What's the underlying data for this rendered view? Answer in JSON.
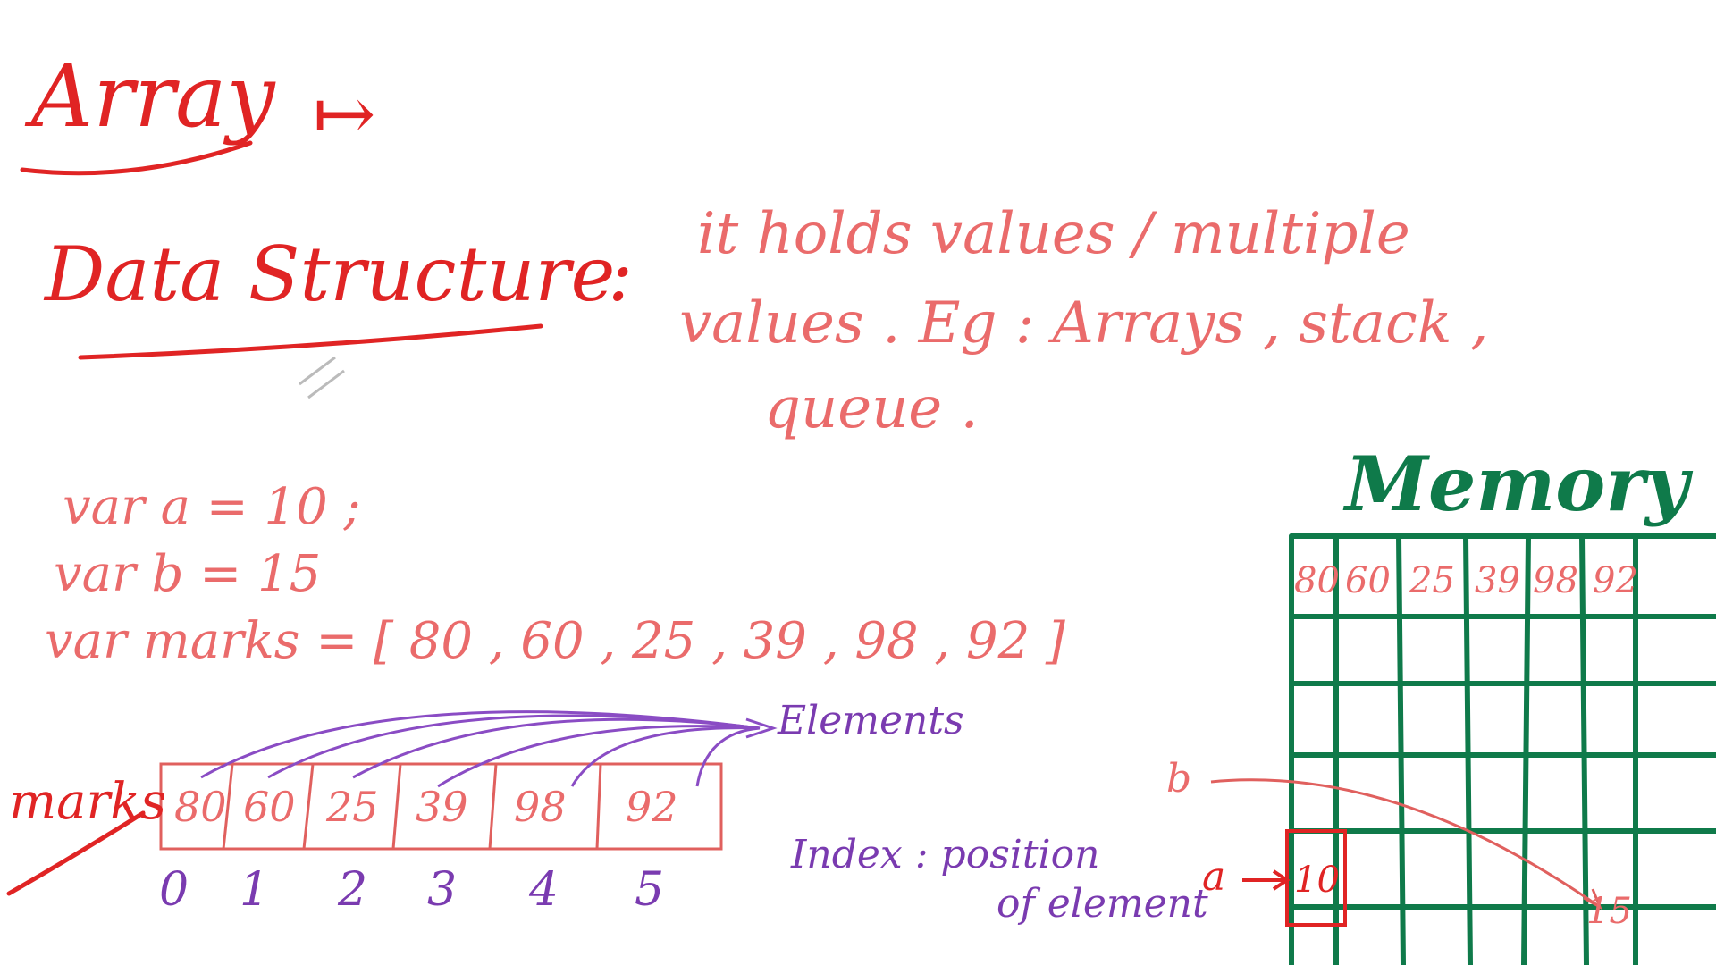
{
  "title": "Array",
  "title_arrow": "↦",
  "heading": "Data Structure",
  "heading_colon": ":",
  "definition": {
    "line1": "it holds values / multiple",
    "line2": "values . Eg : Arrays , stack ,",
    "line3": "queue ."
  },
  "code": {
    "line1": "var  a = 10 ;",
    "line2": "var  b = 15",
    "line3": "var marks = [ 80 , 60 , 25 , 39 , 98 , 92 ]"
  },
  "array_label": "marks",
  "array": {
    "cells": [
      "80",
      "60",
      "25",
      "39",
      "98",
      "92"
    ],
    "indices": [
      "0",
      "1",
      "2",
      "3",
      "4",
      "5"
    ]
  },
  "elements_label": "Elements",
  "index_note": {
    "line1": "Index : position",
    "line2": "of element"
  },
  "memory": {
    "title": "Memory",
    "top_row": [
      "80",
      "60",
      "25",
      "39",
      "98",
      "92"
    ],
    "a_label": "a",
    "a_value": "10",
    "b_label": "b",
    "b_value": "15"
  },
  "colors": {
    "title_red": "#e02424",
    "text_pink": "#ea6b6b",
    "annot_purple": "#7a3bb0",
    "memory_green": "#0f7a4a"
  }
}
